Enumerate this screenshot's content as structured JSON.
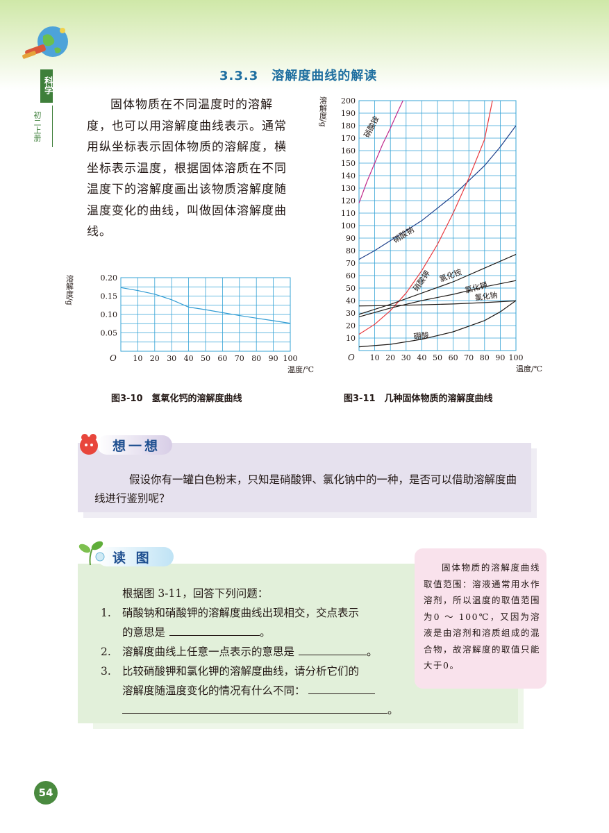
{
  "header": {
    "subject": "科学",
    "grade": "初二上册",
    "section_title": "3.3.3　溶解度曲线的解读"
  },
  "intro_text": "固体物质在不同温度时的溶解度，也可以用溶解度曲线表示。通常用纵坐标表示固体物质的溶解度，横坐标表示温度，根据固体溶质在不同温度下的溶解度画出该物质溶解度随温度变化的曲线，叫做固体溶解度曲线。",
  "chart_data": [
    {
      "type": "line",
      "title": "图3-10　氢氧化钙的溶解度曲线",
      "ylabel": "溶解度/g",
      "xlabel": "温度/℃",
      "origin_label": "O",
      "x_ticks": [
        10,
        20,
        30,
        40,
        50,
        60,
        70,
        80,
        90,
        100
      ],
      "y_ticks": [
        "0.05",
        "0.10",
        "0.15",
        "0.20"
      ],
      "xlim": [
        0,
        100
      ],
      "ylim": [
        0,
        0.2
      ],
      "grid": true,
      "series": [
        {
          "name": "",
          "color": "#2f9bd3",
          "x": [
            0,
            10,
            20,
            30,
            40,
            50,
            60,
            70,
            80,
            90,
            100
          ],
          "y": [
            0.173,
            0.165,
            0.155,
            0.14,
            0.12,
            0.113,
            0.105,
            0.097,
            0.09,
            0.083,
            0.076
          ]
        }
      ]
    },
    {
      "type": "line",
      "title": "图3-11　几种固体物质的溶解度曲线",
      "ylabel": "溶解度/g",
      "xlabel": "温度/℃",
      "origin_label": "O",
      "x_ticks": [
        10,
        20,
        30,
        40,
        50,
        60,
        70,
        80,
        90,
        100
      ],
      "y_ticks": [
        10,
        20,
        30,
        40,
        50,
        60,
        70,
        80,
        90,
        100,
        110,
        120,
        130,
        140,
        150,
        160,
        170,
        180,
        190,
        200
      ],
      "xlim": [
        0,
        100
      ],
      "ylim": [
        0,
        200
      ],
      "grid": true,
      "series": [
        {
          "name": "硝酸铵",
          "color": "#c0288a",
          "x": [
            0,
            5,
            10,
            15,
            20,
            25,
            28
          ],
          "y": [
            118,
            135,
            150,
            165,
            178,
            192,
            200
          ]
        },
        {
          "name": "硝酸钠",
          "color": "#1d3f8a",
          "x": [
            0,
            10,
            20,
            30,
            40,
            50,
            60,
            70,
            80,
            90,
            100
          ],
          "y": [
            73,
            80,
            88,
            96,
            104,
            114,
            124,
            136,
            148,
            163,
            180
          ]
        },
        {
          "name": "硝酸钾",
          "color": "#e8383d",
          "x": [
            0,
            10,
            20,
            30,
            40,
            50,
            60,
            70,
            80,
            85
          ],
          "y": [
            13,
            21,
            32,
            46,
            64,
            85,
            110,
            138,
            169,
            200
          ]
        },
        {
          "name": "氯化铵",
          "color": "#1f1a17",
          "x": [
            0,
            20,
            40,
            60,
            80,
            100
          ],
          "y": [
            29,
            37,
            46,
            55,
            66,
            77
          ]
        },
        {
          "name": "氯化钾",
          "color": "#1f1a17",
          "x": [
            0,
            20,
            40,
            60,
            80,
            100
          ],
          "y": [
            27,
            34,
            40,
            45,
            51,
            56
          ]
        },
        {
          "name": "氯化钠",
          "color": "#1f1a17",
          "x": [
            0,
            20,
            40,
            60,
            80,
            100
          ],
          "y": [
            35.7,
            36,
            36.6,
            37.3,
            38.4,
            39.8
          ]
        },
        {
          "name": "硼酸",
          "color": "#1f1a17",
          "x": [
            0,
            20,
            40,
            60,
            80,
            90,
            100
          ],
          "y": [
            3,
            5,
            9,
            15,
            24,
            31,
            40
          ]
        }
      ]
    }
  ],
  "think": {
    "title": "想一想",
    "text": "假设你有一罐白色粉末，只知是硝酸钾、氯化钠中的一种，是否可以借助溶解度曲线进行鉴别呢？"
  },
  "read": {
    "title": "读 图",
    "intro": "根据图 3-11，回答下列问题：",
    "q1_num": "1.",
    "q1_a": "硝酸钠和硝酸钾的溶解度曲线出现相交，交点表示",
    "q1_b": "的意思是",
    "q1_end": "。",
    "q2_num": "2.",
    "q2": "溶解度曲线上任意一点表示的意思是",
    "q2_end": "。",
    "q3_num": "3.",
    "q3_a": "比较硝酸钾和氯化钾的溶解度曲线，请分析它们的",
    "q3_b": "溶解度随温度变化的情况有什么不同：",
    "q3_end": "。"
  },
  "note_text": "固体物质的溶解度曲线取值范围：溶液通常用水作溶剂，所以温度的取值范围为0 ～ 100℃，又因为溶液是由溶剂和溶质组成的混合物，故溶解度的取值只能大于0。",
  "page_number": "54"
}
